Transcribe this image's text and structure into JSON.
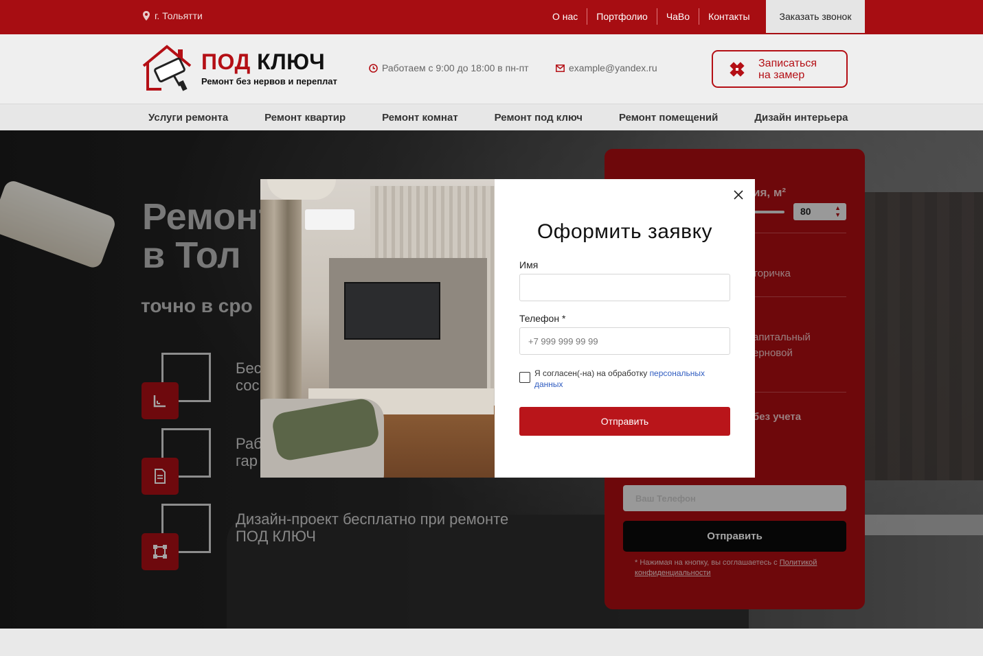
{
  "topbar": {
    "city": "г. Тольятти",
    "nav": [
      "О нас",
      "Портфолио",
      "ЧаВо",
      "Контакты"
    ],
    "call_button": "Заказать звонок"
  },
  "header": {
    "logo_part1": "ПОД",
    "logo_part2": "КЛЮЧ",
    "logo_subtitle": "Ремонт без нервов и переплат",
    "hours": "Работаем с 9:00 до 18:00 в пн-пт",
    "email": "example@yandex.ru",
    "measure_button_line1": "Записаться",
    "measure_button_line2": "на замер"
  },
  "menu": [
    "Услуги ремонта",
    "Ремонт квартир",
    "Ремонт комнат",
    "Ремонт под ключ",
    "Ремонт помещений",
    "Дизайн интерьера"
  ],
  "hero": {
    "title_line1": "Ремонт",
    "title_line2": "в Тол",
    "subtitle": "точно в сро",
    "features": [
      {
        "line1": "Бес",
        "line2": "сос"
      },
      {
        "line1": "Раб",
        "line2": "гар"
      },
      {
        "line1": "Дизайн-проект бесплатно при ремонте",
        "line2": "ПОД КЛЮЧ"
      }
    ]
  },
  "calc_form": {
    "area_label": "ия, м²",
    "area_value": "80",
    "option1": "торичка",
    "option2_line1": "апитальный",
    "option2_line2": "ерновой",
    "option3": "без учета",
    "phone_placeholder": "Ваш Телефон",
    "send_button": "Отправить",
    "note_prefix": "* Нажимая на кнопку, вы соглашаетесь с ",
    "note_link": "Политикой конфиденциальности"
  },
  "modal": {
    "title": "Оформить заявку",
    "name_label": "Имя",
    "name_value": "",
    "phone_label": "Телефон *",
    "phone_placeholder": "+7 999 999 99 99",
    "agree_text": "Я согласен(-на) на обработку ",
    "agree_link": "персональных данных",
    "submit": "Отправить"
  },
  "colors": {
    "brand_red": "#a70d12",
    "button_red": "#b9151a",
    "dark": "#0a0a0a"
  }
}
